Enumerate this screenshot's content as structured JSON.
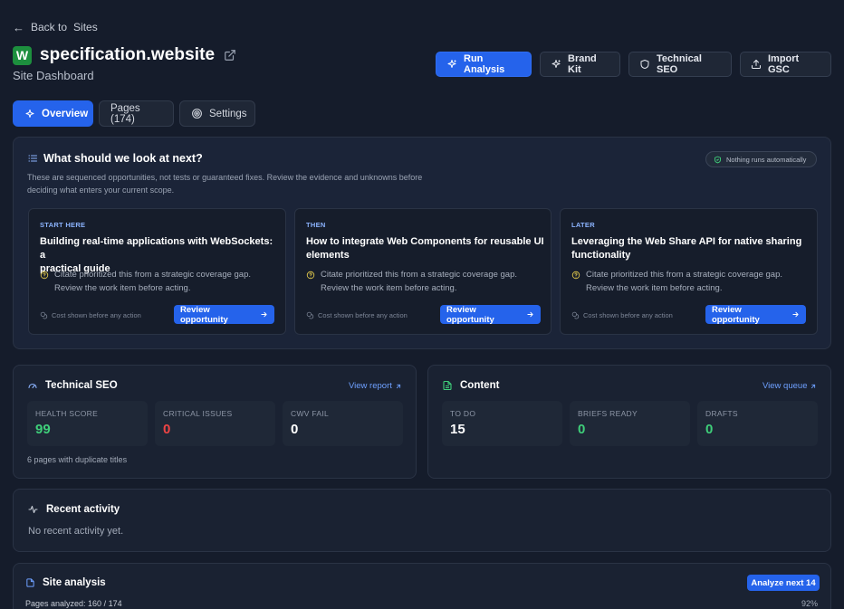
{
  "header": {
    "back_arrow": "←",
    "back_label": "Back to",
    "back_target": "Sites",
    "logo_letter": "W",
    "site_name": "specification.website",
    "subtitle": "Site Dashboard",
    "buttons": {
      "run_analysis": "Run Analysis",
      "brand_kit": "Brand Kit",
      "technical_seo": "Technical SEO",
      "import_gsc": "Import GSC"
    }
  },
  "tabs": {
    "overview": "Overview",
    "pages": "Pages (174)",
    "settings": "Settings"
  },
  "next": {
    "title": "What should we look at next?",
    "description_line1": "These are sequenced opportunities, not tests or guaranteed fixes. Review the evidence and unknowns before",
    "description_line2": "deciding what enters your current scope.",
    "pill": "Nothing runs automatically",
    "cards": [
      {
        "step": "START HERE",
        "title_line1": "Building real-time applications with WebSockets: a",
        "title_line2": "practical guide",
        "note_line1": "Citate prioritized this from a strategic coverage gap.",
        "note_line2": "Review the work item before acting.",
        "cost": "Cost shown before any action",
        "button": "Review opportunity"
      },
      {
        "step": "THEN",
        "title_line1": "How to integrate Web Components for reusable UI",
        "title_line2": "elements",
        "note_line1": "Citate prioritized this from a strategic coverage gap.",
        "note_line2": "Review the work item before acting.",
        "cost": "Cost shown before any action",
        "button": "Review opportunity"
      },
      {
        "step": "LATER",
        "title_line1": "Leveraging the Web Share API for native sharing",
        "title_line2": "functionality",
        "note_line1": "Citate prioritized this from a strategic coverage gap.",
        "note_line2": "Review the work item before acting.",
        "cost": "Cost shown before any action",
        "button": "Review opportunity"
      }
    ]
  },
  "technical_seo": {
    "title": "Technical SEO",
    "link": "View report",
    "stats": [
      {
        "label": "HEALTH SCORE",
        "value": "99"
      },
      {
        "label": "CRITICAL ISSUES",
        "value": "0"
      },
      {
        "label": "CWV FAIL",
        "value": "0"
      }
    ],
    "footnote": "6 pages with duplicate titles"
  },
  "content": {
    "title": "Content",
    "link": "View queue",
    "stats": [
      {
        "label": "TO DO",
        "value": "15"
      },
      {
        "label": "BRIEFS READY",
        "value": "0"
      },
      {
        "label": "DRAFTS",
        "value": "0"
      }
    ]
  },
  "recent_activity": {
    "title": "Recent activity",
    "empty": "No recent activity yet."
  },
  "site_analysis": {
    "title": "Site analysis",
    "button": "Analyze next 14",
    "progress_label": "Pages analyzed: 160 / 174",
    "progress_percent": "92%"
  },
  "colors": {
    "accent": "#2563eb",
    "good": "#3fcf7a",
    "bad": "#ef4444",
    "link": "#6ea0ff"
  },
  "icons": [
    "back-arrow-icon",
    "external-link-icon",
    "sparkles-icon",
    "sparkle-icon",
    "shield-icon",
    "upload-icon",
    "target-icon",
    "list-icon",
    "check-shield-icon",
    "help-circle-icon",
    "coins-icon",
    "arrow-right-icon",
    "gauge-icon",
    "arrow-up-right-icon",
    "document-icon",
    "pulse-icon",
    "file-icon"
  ]
}
